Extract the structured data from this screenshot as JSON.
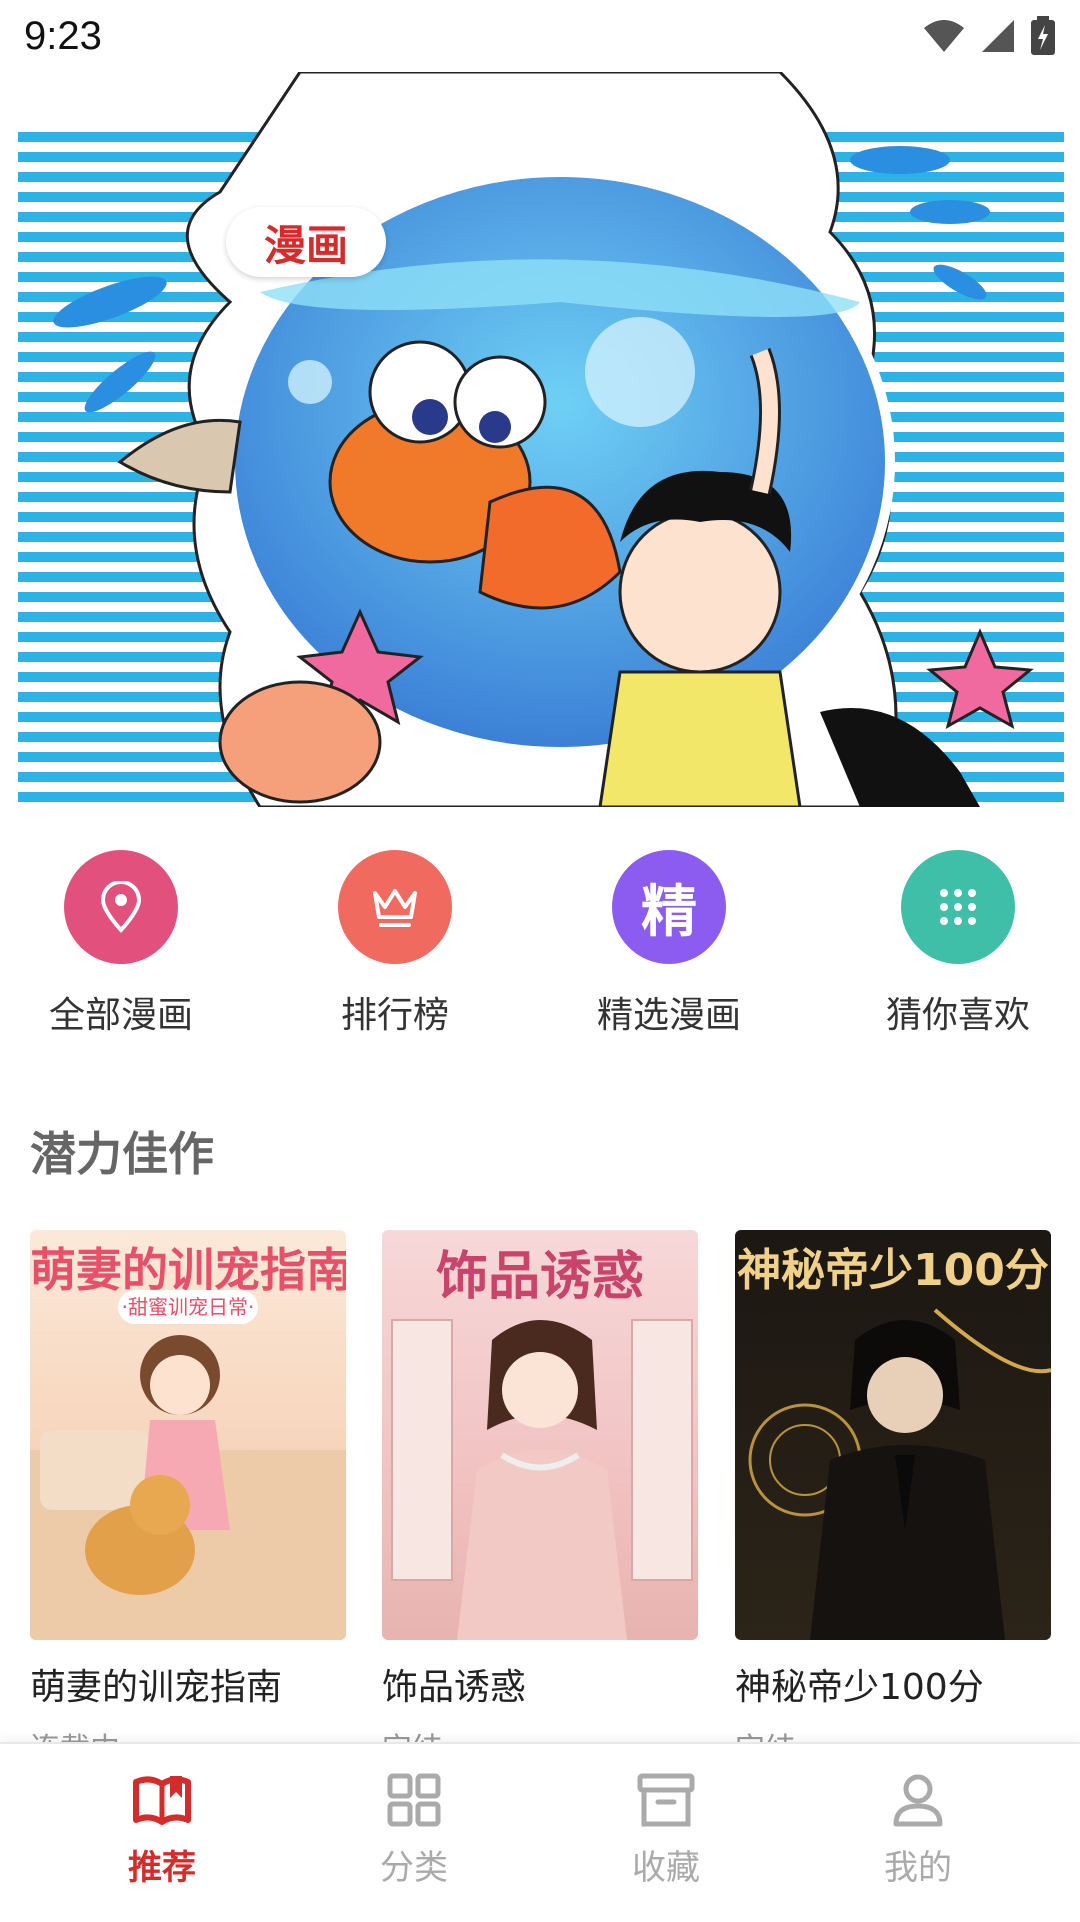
{
  "status_bar": {
    "time": "9:23",
    "icons": [
      "wifi-icon",
      "signal-icon",
      "battery-icon"
    ]
  },
  "banner": {
    "tag": "漫画"
  },
  "quick_nav": [
    {
      "label": "全部漫画",
      "icon": "location-pin-icon",
      "color": "#e2517d"
    },
    {
      "label": "排行榜",
      "icon": "crown-icon",
      "color": "#f06a5f"
    },
    {
      "label": "精选漫画",
      "icon": "jing-character-icon",
      "icon_text": "精",
      "color": "#8c5cf0"
    },
    {
      "label": "猜你喜欢",
      "icon": "grid-dots-icon",
      "color": "#3fbfa7"
    }
  ],
  "section": {
    "title": "潜力佳作"
  },
  "cards": [
    {
      "cover_title": "萌妻的训宠指南",
      "cover_subtitle": "·甜蜜训宠日常·",
      "title": "萌妻的训宠指南",
      "status": "连载中"
    },
    {
      "cover_title": "饰品诱惑",
      "title": "饰品诱惑",
      "status": "完结"
    },
    {
      "cover_title": "神秘帝少100分",
      "title": "神秘帝少100分",
      "status": "完结"
    }
  ],
  "tabbar": [
    {
      "label": "推荐",
      "icon": "open-book-icon",
      "active": true
    },
    {
      "label": "分类",
      "icon": "grid-icon",
      "active": false
    },
    {
      "label": "收藏",
      "icon": "archive-box-icon",
      "active": false
    },
    {
      "label": "我的",
      "icon": "person-icon",
      "active": false
    }
  ],
  "colors": {
    "accent": "#d62b2b",
    "inactive": "#aaaaaa"
  }
}
